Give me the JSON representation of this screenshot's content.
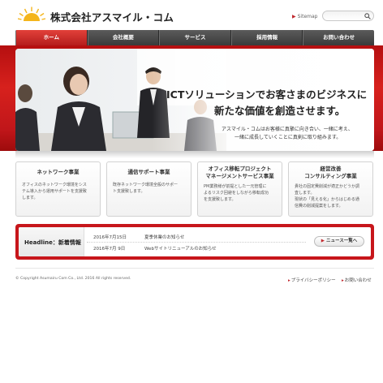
{
  "header": {
    "company_name": "株式会社アスマイル・コム",
    "sitemap_label": "Sitemap",
    "search_placeholder": ""
  },
  "nav": {
    "items": [
      {
        "label": "ホーム",
        "active": true
      },
      {
        "label": "会社概要",
        "active": false
      },
      {
        "label": "サービス",
        "active": false
      },
      {
        "label": "採用情報",
        "active": false
      },
      {
        "label": "お問い合わせ",
        "active": false
      }
    ]
  },
  "hero": {
    "headline_line1": "ICTソリューションでお客さまのビジネスに",
    "headline_line2": "新たな価値を創造させます。",
    "sub_line1": "アスマイル・コムはお客様に真摯に向き合い、一緒に考え、",
    "sub_line2": "一緒に成長していくことに真剣に取り組みます。"
  },
  "services": [
    {
      "title_lines": [
        "ネットワーク事業"
      ],
      "desc_lines": [
        "オフィスのネットワーク環境をシス",
        "テム導入から運用サポートを支援致",
        "します。"
      ]
    },
    {
      "title_lines": [
        "通信サポート事業"
      ],
      "desc_lines": [
        "既存ネットワーク環境全般のサポー",
        "ト支援致します。"
      ]
    },
    {
      "title_lines": [
        "オフィス移転プロジェクト",
        "マネージメントサービス事業"
      ],
      "desc_lines": [
        "PM業務様が前提とした一元管理に",
        "よるリスク回避をしながら移転成功",
        "を支援致します。"
      ]
    },
    {
      "title_lines": [
        "経営改善",
        "コンサルティング事業"
      ],
      "desc_lines": [
        "貴社の固定費削減が適正かどうか調",
        "査します。",
        "現状の「見える化」からはじめる通",
        "信費の削減提案をします。"
      ]
    }
  ],
  "headline": {
    "label": "Headline：新着情報",
    "news": [
      {
        "date": "2016年7月15日",
        "title": "夏季休業のお知らせ"
      },
      {
        "date": "2016年7月 9日",
        "title": "Webサイトリニューアルのお知らせ"
      }
    ],
    "more_button": "ニュース一覧へ"
  },
  "footer": {
    "copyright": "© Copyright Asumairu Com Co., Ltd. 2016 All rights reserved.",
    "privacy_link": "プライバシーポリシー",
    "contact_link": "お問い合わせ"
  },
  "colors": {
    "accent_red": "#c7161b",
    "nav_dark": "#444444"
  }
}
